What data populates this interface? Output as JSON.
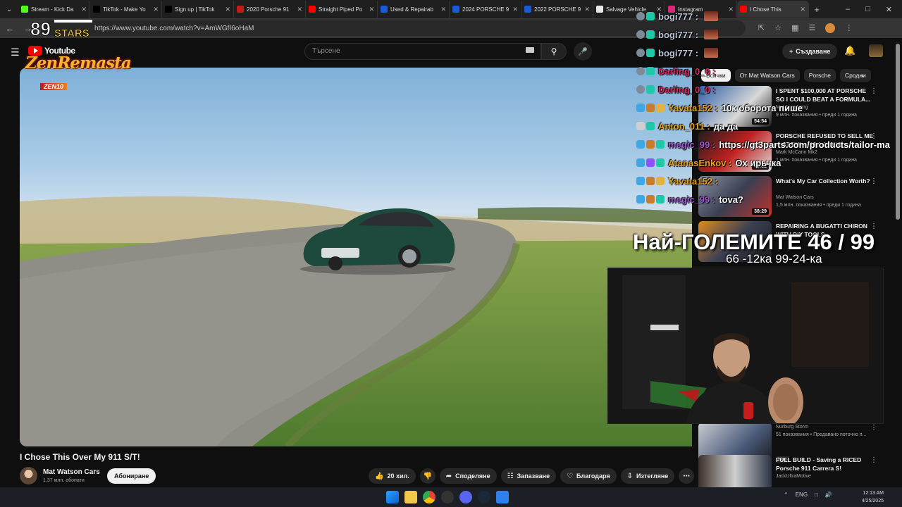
{
  "browser": {
    "tabs": [
      {
        "title": "Stream - Kick Da",
        "color": "#53fc18"
      },
      {
        "title": "TikTok - Make Yo",
        "color": "#000000"
      },
      {
        "title": "Sign up | TikTok",
        "color": "#000000"
      },
      {
        "title": "2020 Porsche 91",
        "color": "#c41a1a"
      },
      {
        "title": "Straight Piped Po",
        "color": "#ff0000"
      },
      {
        "title": "Used & Repairab",
        "color": "#1a5ad7"
      },
      {
        "title": "2024 PORSCHE 9",
        "color": "#1a5ad7"
      },
      {
        "title": "2022 PORSCHE 9",
        "color": "#1a5ad7"
      },
      {
        "title": "Salvage Vehicle",
        "color": "#e8e8e8"
      },
      {
        "title": "Instagram",
        "color": "#d62976"
      },
      {
        "title": "I Chose This",
        "color": "#ff0000"
      }
    ],
    "url": "https://www.youtube.com/watch?v=AmWGfI6oHaM"
  },
  "youtube": {
    "logo_text": "Youtube",
    "search_placeholder": "Търсене",
    "create_label": "Създаване"
  },
  "video": {
    "title": "I Chose This Over My 911 S/T!",
    "channel": "Mat Watson Cars",
    "subscribers": "1,37 млн. абонати",
    "subscribe_label": "Абониране",
    "likes": "20 хил.",
    "share_label": "Споделяне",
    "save_label": "Запазване",
    "thanks_label": "Благодаря",
    "download_label": "Изтегляне"
  },
  "chips": [
    "Всички",
    "От Mat Watson Cars",
    "Porsche",
    "Сродни"
  ],
  "recommendations": [
    {
      "title": "I SPENT $100,000 AT PORSCHE SO I COULD BEAT A FORMULA...",
      "channel": "Mat Armstrong",
      "meta": "9 млн. показвания • преди 1 година",
      "duration": "54:54"
    },
    {
      "title": "PORSCHE REFUSED TO SELL ME A GT3RS - FULL MOVIE",
      "channel": "Mark McCann Mk2",
      "meta": "1 млн. показвания • преди 1 година",
      "duration": "49:32"
    },
    {
      "title": "What's My Car Collection Worth?",
      "channel": "Mat Watson Cars",
      "meta": "1,5 млн. показвания • преди 1 година",
      "duration": "38:29"
    },
    {
      "title": "REPAIRING A BUGATTI CHIRON WITH DIY TOOLS",
      "channel": "",
      "meta": "",
      "duration": ""
    },
    {
      "title": "",
      "channel": "Nurburg Storm",
      "meta": "51 показвания • Предавано поточно п...",
      "duration": "3:17:45",
      "badge": "Нов"
    },
    {
      "title": "FULL BUILD - Saving a RICED Porsche 911 Carrera S!",
      "channel": "JackUltraMotive",
      "meta": "",
      "duration": ""
    }
  ],
  "overlay": {
    "stars_logo": "89 STARS",
    "zen_logo": "ZenRemasta",
    "zen_badge": "ZEN10",
    "big_title": "Най-ГОЛЕМИТЕ 46 / 99",
    "big_sub": "66 -12ка 99-24-ка",
    "chat": [
      {
        "user": "bogi777 :",
        "text": "",
        "color": "#b9c3d6"
      },
      {
        "user": "bogi777 :",
        "text": "",
        "color": "#b9c3d6"
      },
      {
        "user": "bogi777 :",
        "text": "",
        "color": "#b9c3d6"
      },
      {
        "user": "Darling_0_0 :",
        "text": "",
        "color": "#e0245e"
      },
      {
        "user": "Darling_0_0 :",
        "text": "",
        "color": "#e0245e"
      },
      {
        "user": "Yavata152 :",
        "text": "10к оборота пише",
        "color": "#e8a317"
      },
      {
        "user": "Anton_011 :",
        "text": "да да",
        "color": "#e8a317"
      },
      {
        "user": "megic_99 :",
        "text": "https://gt3parts.com/products/tailor-ma",
        "color": "#9b59d0"
      },
      {
        "user": "AtanasEnkov :",
        "text": "Ох ирьчка",
        "color": "#e8a317"
      },
      {
        "user": "Yavata152 :",
        "text": "",
        "color": "#e8a317"
      },
      {
        "user": "megic_99 :",
        "text": "tova?",
        "color": "#9b59d0"
      }
    ]
  },
  "taskbar": {
    "lang": "ENG",
    "time": "12:13 AM",
    "date": "4/25/2025"
  }
}
